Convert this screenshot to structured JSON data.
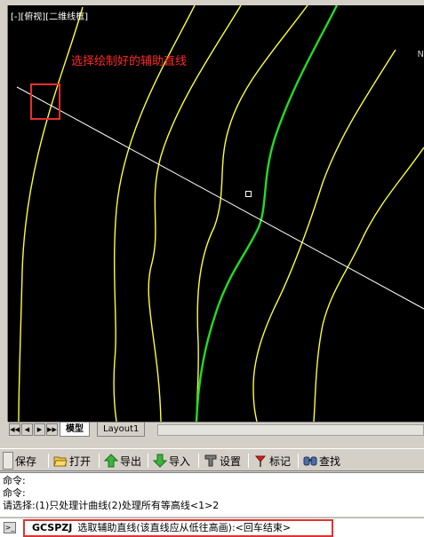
{
  "viewport": {
    "label": "[-][俯视][二维线框]",
    "instruction": "选择绘制好的辅助直线",
    "edge_mark": "N"
  },
  "layout_tabs": [
    {
      "label": "模型",
      "active": true
    },
    {
      "label": "Layout1",
      "active": false
    }
  ],
  "nav_buttons": [
    "◀◀",
    "◀",
    "▶",
    "▶▶"
  ],
  "toolbar": {
    "items": [
      {
        "label": "保存",
        "icon": "save-icon"
      },
      {
        "label": "打开",
        "icon": "folder-open-icon"
      },
      {
        "label": "导出",
        "icon": "arrow-up-icon"
      },
      {
        "label": "导入",
        "icon": "arrow-down-icon"
      },
      {
        "label": "设置",
        "icon": "wrench-icon"
      },
      {
        "label": "标记",
        "icon": "flag-icon"
      },
      {
        "label": "查找",
        "icon": "binoculars-icon"
      }
    ]
  },
  "command_history": [
    "命令:",
    "命令:",
    "请选择:(1)只处理计曲线(2)处理所有等高线<1>2"
  ],
  "prompt": {
    "command": "GCSPZJ",
    "text": "选取辅助直线(该直线应从低往高画):<回车结束>"
  },
  "colors": {
    "contour": "#ffff33",
    "index_contour": "#22dd22",
    "aux_line": "#ffffff",
    "highlight": "#e53030",
    "background": "#000000"
  }
}
